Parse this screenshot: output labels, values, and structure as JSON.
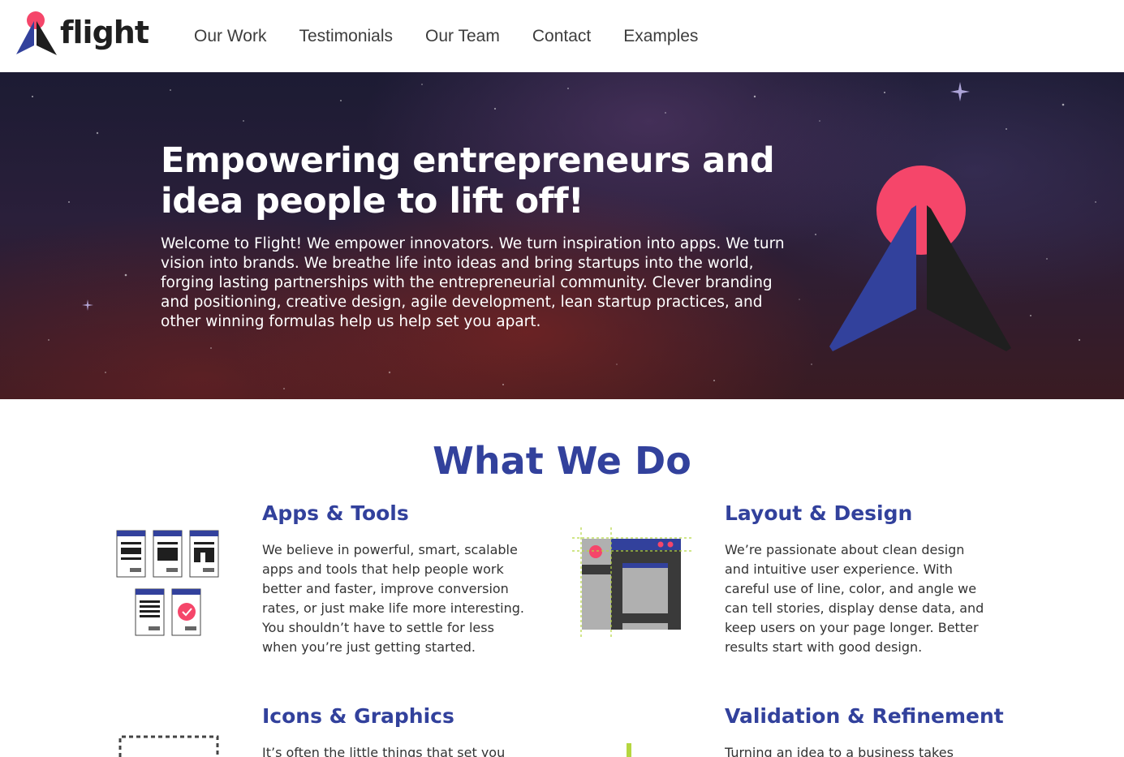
{
  "brand": {
    "logo_text": "flight"
  },
  "nav": {
    "items": [
      {
        "label": "Our Work"
      },
      {
        "label": "Testimonials"
      },
      {
        "label": "Our Team"
      },
      {
        "label": "Contact"
      },
      {
        "label": "Examples"
      }
    ]
  },
  "hero": {
    "title": "Empowering entrepreneurs and idea people to lift off!",
    "body": "Welcome to Flight! We empower innovators. We turn inspiration into apps. We turn vision into brands. We breathe life into ideas and bring startups into the world, forging lasting partnerships with the entrepreneurial community. Clever branding and positioning, creative design, agile development, lean startup practices, and other winning formulas help us help set you apart."
  },
  "what_we_do": {
    "title": "What We Do",
    "services": [
      {
        "heading": "Apps & Tools",
        "icon": "app-screens-icon",
        "text": "We believe in powerful, smart, scalable apps and tools that help people work better and faster, improve conversion rates, or just make life more interesting. You shouldn’t have to settle for less when you’re just getting started."
      },
      {
        "heading": "Layout & Design",
        "icon": "layout-grid-icon",
        "text": "We’re passionate about clean design and intuitive user experience. With careful use of line, color, and angle we can tell stories, display dense data, and keep users on your page longer. Better results start with good design."
      },
      {
        "heading": "Icons & Graphics",
        "icon": "dashed-frame-icon",
        "text": "It’s often the little things that set you"
      },
      {
        "heading": "Validation & Refinement",
        "icon": "bar-growth-icon",
        "text": "Turning an idea to a business takes"
      }
    ]
  },
  "colors": {
    "brand_blue": "#32419c",
    "brand_pink": "#f5466a",
    "brand_dark": "#1f1f1f",
    "guide_green": "#b5d640"
  }
}
